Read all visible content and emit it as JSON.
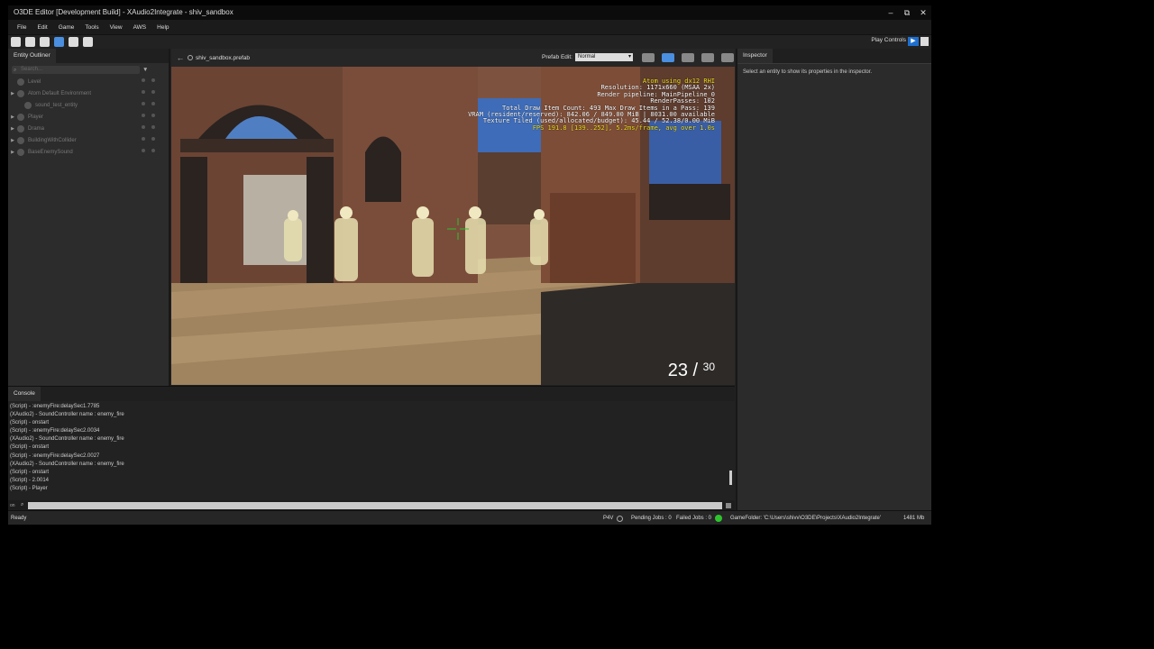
{
  "window": {
    "title": "O3DE Editor [Development Build] - XAudio2Integrate - shiv_sandbox",
    "minimize_icon": "–",
    "restore_icon": "⧉",
    "close_icon": "✕"
  },
  "menu": [
    "File",
    "Edit",
    "Game",
    "Tools",
    "View",
    "AWS",
    "Help"
  ],
  "toolbar": {
    "play_controls_label": "Play Controls",
    "play_icon": "▶"
  },
  "outliner": {
    "tab": "Entity Outliner",
    "search_placeholder": "Search...",
    "filter_icon": "▼",
    "rows": [
      {
        "label": "Level",
        "arrow": ""
      },
      {
        "label": "Atom Default Environment",
        "arrow": "▶"
      },
      {
        "label": "sound_test_entity",
        "arrow": ""
      },
      {
        "label": "Player",
        "arrow": "▶"
      },
      {
        "label": "Drama",
        "arrow": "▶"
      },
      {
        "label": "BuildingWithCollider",
        "arrow": "▶"
      },
      {
        "label": "BaseEnemySound",
        "arrow": "▶"
      }
    ]
  },
  "viewport": {
    "back_icon": "←",
    "prefab_name": "shiv_sandbox.prefab",
    "prefab_edit_label": "Prefab Edit:",
    "prefab_edit_value": "Normal",
    "hud": [
      {
        "text": "Atom using dx12 RHI",
        "color": "yellow"
      },
      {
        "text": "Resolution: 1171x660 (MSAA 2x)",
        "color": "white"
      },
      {
        "text": "Render pipeline: MainPipeline_0",
        "color": "white"
      },
      {
        "text": "RenderPasses: 102",
        "color": "white"
      },
      {
        "text": "Total Draw Item Count: 493  Max Draw Items in a Pass: 139",
        "color": "white"
      },
      {
        "text": "VRAM (resident/reserved): 842.06 / 849.00 MiB | 8031.00 available",
        "color": "white"
      },
      {
        "text": "Texture Tiled (used/allocated/budget): 45.44 / 52.38/0.00 MiB",
        "color": "white"
      },
      {
        "text": "FPS 191.8 [139..252], 5.2ms/frame, avg over 1.0s",
        "color": "yellow"
      }
    ],
    "ammo_current": "23",
    "ammo_sep": "/",
    "ammo_max": "30"
  },
  "inspector": {
    "tab": "Inspector",
    "message": "Select an entity to show its properties in the inspector."
  },
  "console": {
    "tab": "Console",
    "lines": [
      "(Script) - :enemyFire:delaySec1.7785",
      "(XAudio2) - SoundController name : enemy_fire",
      "(Script) - onstart",
      "(Script) - :enemyFire:delaySec2.0034",
      "(XAudio2) - SoundController name : enemy_fire",
      "(Script) - onstart",
      "(Script) - :enemyFire:delaySec2.0027",
      "(XAudio2) - SoundController name : enemy_fire",
      "(Script) - onstart",
      "(Script) - 2.0014",
      "(Script) - Player"
    ],
    "input_label": "on"
  },
  "status": {
    "ready": "Ready",
    "p4v": "P4V",
    "pending_jobs": "Pending Jobs : 0",
    "failed_jobs": "Failed Jobs : 0",
    "gamefolder": "GameFolder: 'C:\\Users\\shivv\\O3DE\\Projects\\XAudio2Integrate'",
    "memory": "1481 Mb"
  },
  "colors": {
    "accent": "#1e6fd0",
    "status_ok": "#2ec42e",
    "hud_yellow": "#f0e020"
  }
}
